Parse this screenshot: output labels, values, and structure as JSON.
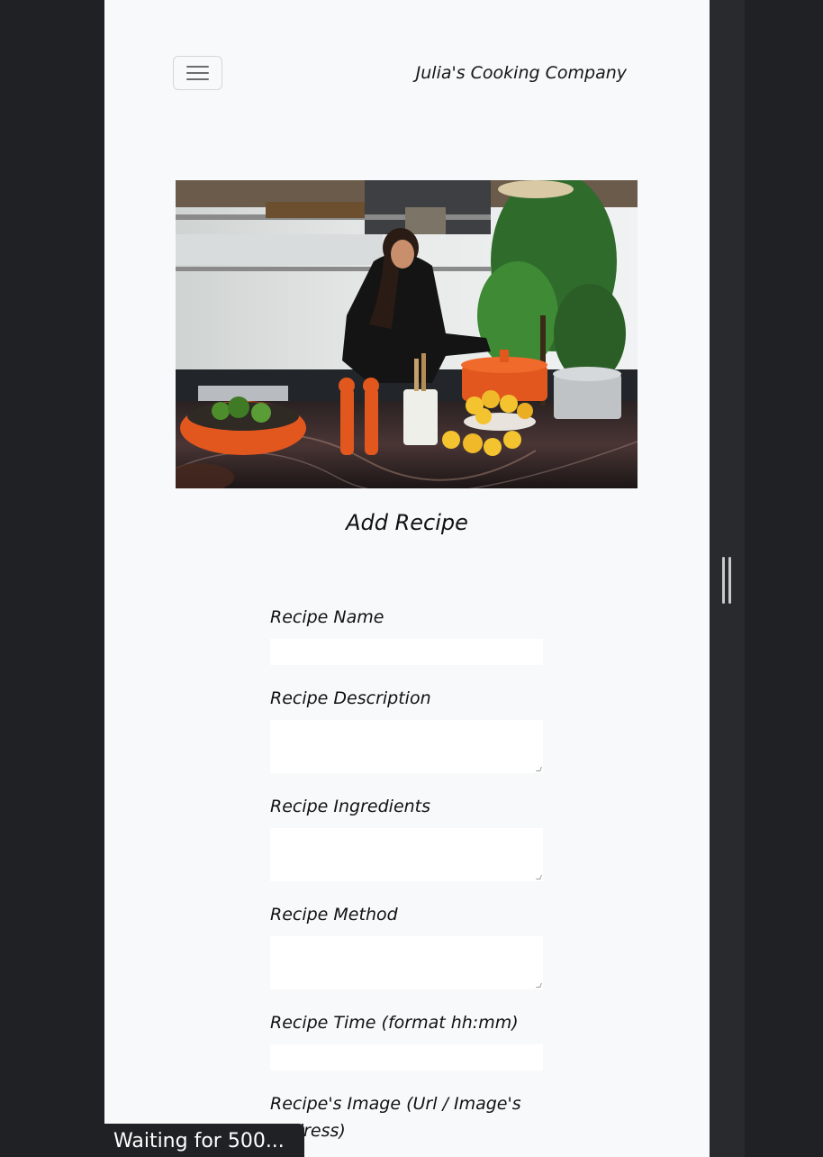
{
  "navbar": {
    "brand": "Julia's Cooking Company",
    "toggle_icon": "menu-icon"
  },
  "hero": {
    "image_description": "kitchen-photo",
    "colors": {
      "pot": "#e2571e",
      "lemon": "#f4c430",
      "counter": "#3b2a2a",
      "plant": "#2f6b2b"
    }
  },
  "form": {
    "title": "Add Recipe",
    "fields": [
      {
        "label": "Recipe Name",
        "type": "input",
        "value": ""
      },
      {
        "label": "Recipe Description",
        "type": "textarea",
        "value": ""
      },
      {
        "label": "Recipe Ingredients",
        "type": "textarea",
        "value": ""
      },
      {
        "label": "Recipe Method",
        "type": "textarea",
        "value": ""
      },
      {
        "label": "Recipe Time (format hh:mm)",
        "type": "input",
        "value": ""
      },
      {
        "label": "Recipe's Image (Url / Image's",
        "label_line2": "Address)",
        "type": "input",
        "value": ""
      }
    ]
  },
  "status_bar": {
    "text": "Waiting for 500..."
  }
}
